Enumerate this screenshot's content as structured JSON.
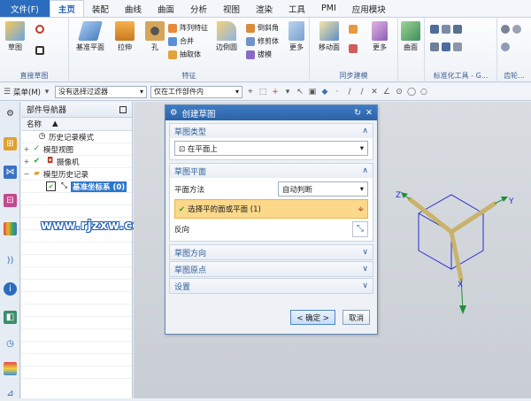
{
  "menubar": {
    "items": [
      "文件(F)",
      "主页",
      "装配",
      "曲线",
      "曲面",
      "分析",
      "视图",
      "渲染",
      "工具",
      "PMI",
      "应用模块"
    ]
  },
  "ribbon": {
    "groups": [
      {
        "label": "直接草图",
        "buttons": [
          "草图"
        ]
      },
      {
        "label": "特征",
        "buttons": [
          "基准平面",
          "拉伸",
          "孔",
          "阵列特征",
          "合并",
          "抽取体",
          "边倒圆",
          "倒斜角",
          "修剪体",
          "拔模",
          "更多"
        ]
      },
      {
        "label": "同步建模",
        "buttons": [
          "移动面",
          "更多"
        ]
      },
      {
        "label": "",
        "buttons": [
          "曲面"
        ]
      },
      {
        "label": "标准化工具 - G...",
        "buttons": []
      },
      {
        "label": "齿轮...",
        "buttons": []
      }
    ]
  },
  "toolbar": {
    "menu_label": "菜单(M)",
    "filter_value": "没有选择过滤器",
    "scope_value": "仅在工作部件内"
  },
  "navigator": {
    "title": "部件导航器",
    "col_name": "名称",
    "items": [
      {
        "label": "历史记录模式"
      },
      {
        "label": "模型视图"
      },
      {
        "label": "摄像机"
      },
      {
        "label": "模型历史记录"
      },
      {
        "label": "基准坐标系 (0)"
      }
    ]
  },
  "watermark": "www.rjzxw.com",
  "dialog": {
    "title": "创建草图",
    "sections": {
      "sketch_type": {
        "label": "草图类型",
        "value": "在平面上"
      },
      "sketch_plane": {
        "label": "草图平面",
        "plane_method_label": "平面方法",
        "plane_method_value": "自动判断",
        "select_label": "选择平的面或平面 (1)",
        "reverse_label": "反向"
      },
      "sketch_direction": {
        "label": "草图方向"
      },
      "sketch_origin": {
        "label": "草图原点"
      },
      "settings": {
        "label": "设置"
      }
    },
    "ok_label": "< 确定 >",
    "cancel_label": "取消"
  },
  "axes": {
    "x": "X",
    "y": "Y",
    "z": "Z"
  },
  "colors": {
    "accent": "#2b6cbe",
    "highlight": "#fbd88a",
    "check": "#2fa12f"
  }
}
